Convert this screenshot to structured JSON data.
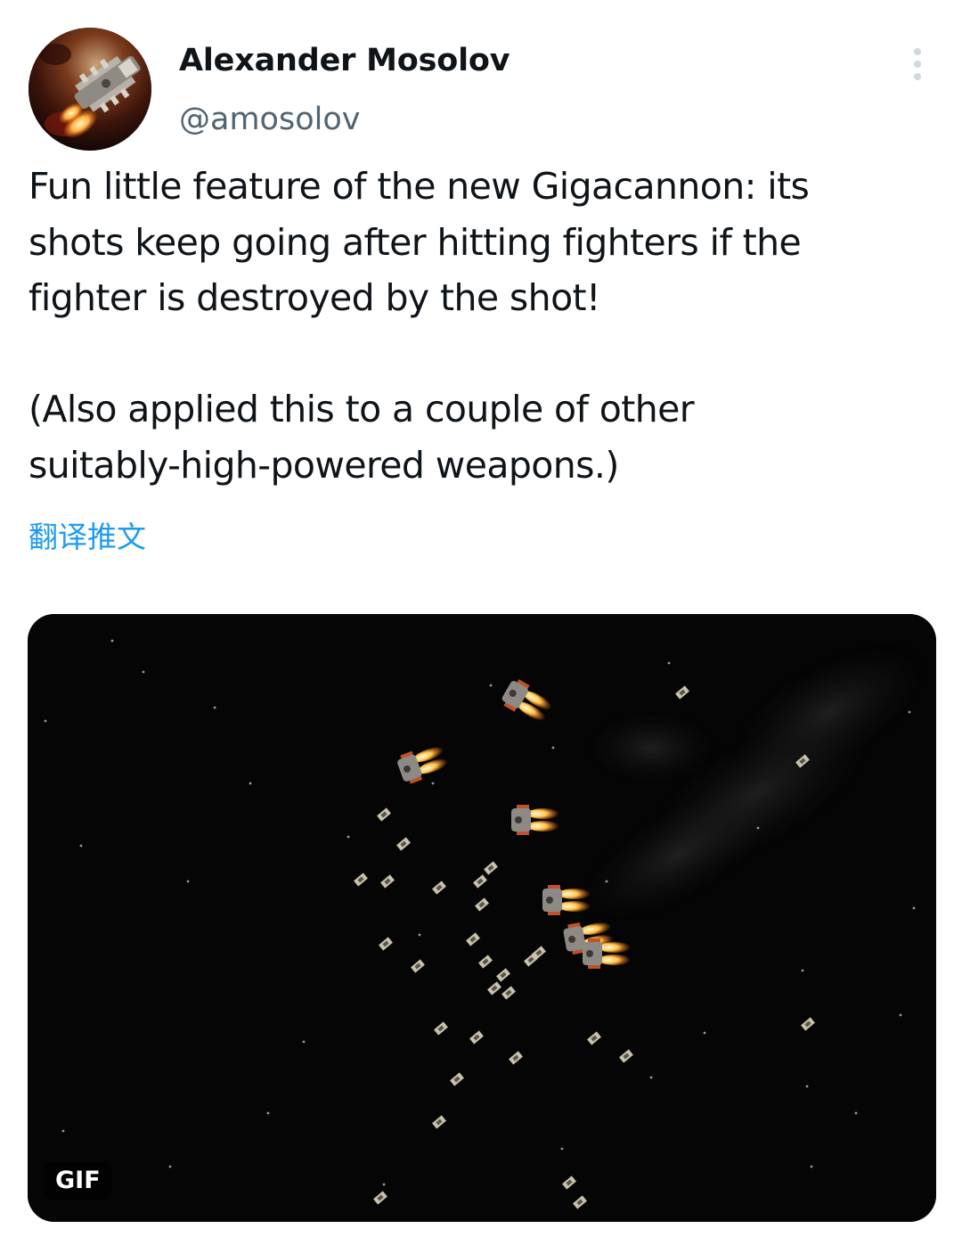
{
  "tweet": {
    "author_name": "Alexander Mosolov",
    "author_handle": "@amosolov",
    "text_lines": [
      "Fun little feature of the new Gigacannon: its",
      "shots keep going after hitting fighters if the",
      "fighter is destroyed by the shot!",
      "",
      "(Also applied this to a couple of other",
      "suitably-high-powered weapons.)"
    ],
    "translate_label": "翻译推文",
    "media": {
      "type": "gif",
      "badge_label": "GIF"
    }
  },
  "icons": {
    "more": "more-vertical-icon",
    "avatar": "spaceship-avatar"
  },
  "colors": {
    "text_primary": "#0f1419",
    "text_secondary": "#536471",
    "link": "#1d9bf0",
    "more_icon": "#cfd9de",
    "media_background": "#050505"
  }
}
